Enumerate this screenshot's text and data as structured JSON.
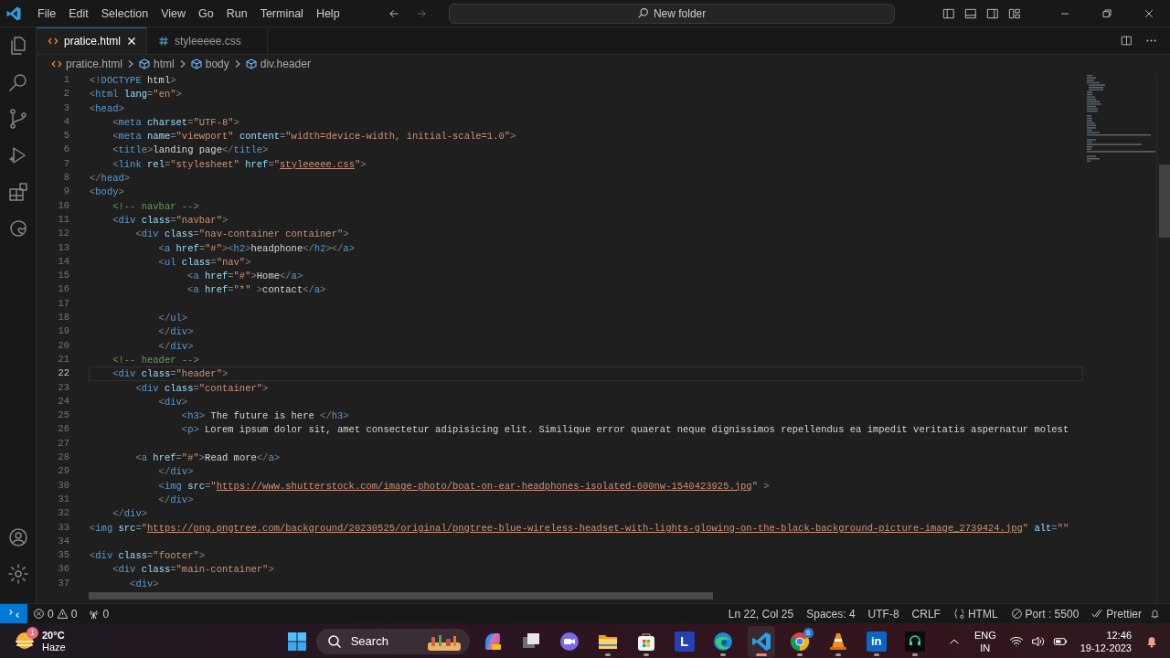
{
  "title_bar": {
    "menu": [
      "File",
      "Edit",
      "Selection",
      "View",
      "Go",
      "Run",
      "Terminal",
      "Help"
    ],
    "command_center": "New folder"
  },
  "tabs": [
    {
      "label": "pratice.html",
      "kind": "html",
      "selected": true
    },
    {
      "label": "styleeeee.css",
      "kind": "css",
      "selected": false
    }
  ],
  "breadcrumb": [
    {
      "label": "pratice.html",
      "kind": "file"
    },
    {
      "label": "html",
      "kind": "element"
    },
    {
      "label": "body",
      "kind": "element"
    },
    {
      "label": "div.header",
      "kind": "element"
    }
  ],
  "editor": {
    "lines": [
      {
        "number": "1",
        "current": false,
        "tokens": [
          {
            "kind": "punct",
            "text": "<!"
          },
          {
            "kind": "tag",
            "text": "DOCTYPE"
          },
          {
            "kind": "text",
            "text": " html"
          },
          {
            "kind": "punct",
            "text": ">"
          }
        ]
      },
      {
        "number": "2",
        "current": false,
        "tokens": [
          {
            "kind": "punct",
            "text": "<"
          },
          {
            "kind": "tag",
            "text": "html"
          },
          {
            "kind": "attr",
            "text": " lang"
          },
          {
            "kind": "punct",
            "text": "="
          },
          {
            "kind": "str",
            "text": "\"en\""
          },
          {
            "kind": "punct",
            "text": ">"
          }
        ]
      },
      {
        "number": "3",
        "current": false,
        "tokens": [
          {
            "kind": "punct",
            "text": "<"
          },
          {
            "kind": "tag",
            "text": "head"
          },
          {
            "kind": "punct",
            "text": ">"
          }
        ]
      },
      {
        "number": "4",
        "current": false,
        "tokens": [
          {
            "kind": "punct",
            "text": "    <"
          },
          {
            "kind": "tag",
            "text": "meta"
          },
          {
            "kind": "attr",
            "text": " charset"
          },
          {
            "kind": "punct",
            "text": "="
          },
          {
            "kind": "str",
            "text": "\"UTF-8\""
          },
          {
            "kind": "punct",
            "text": ">"
          }
        ]
      },
      {
        "number": "5",
        "current": false,
        "tokens": [
          {
            "kind": "punct",
            "text": "    <"
          },
          {
            "kind": "tag",
            "text": "meta"
          },
          {
            "kind": "attr",
            "text": " name"
          },
          {
            "kind": "punct",
            "text": "="
          },
          {
            "kind": "str",
            "text": "\"viewport\""
          },
          {
            "kind": "attr",
            "text": " content"
          },
          {
            "kind": "punct",
            "text": "="
          },
          {
            "kind": "str",
            "text": "\"width=device-width, initial-scale=1.0\""
          },
          {
            "kind": "punct",
            "text": ">"
          }
        ]
      },
      {
        "number": "6",
        "current": false,
        "tokens": [
          {
            "kind": "punct",
            "text": "    <"
          },
          {
            "kind": "tag",
            "text": "title"
          },
          {
            "kind": "punct",
            "text": ">"
          },
          {
            "kind": "text",
            "text": "landing page"
          },
          {
            "kind": "punct",
            "text": "</"
          },
          {
            "kind": "tag",
            "text": "title"
          },
          {
            "kind": "punct",
            "text": ">"
          }
        ]
      },
      {
        "number": "7",
        "current": false,
        "tokens": [
          {
            "kind": "punct",
            "text": "    <"
          },
          {
            "kind": "tag",
            "text": "link"
          },
          {
            "kind": "attr",
            "text": " rel"
          },
          {
            "kind": "punct",
            "text": "="
          },
          {
            "kind": "str",
            "text": "\"stylesheet\""
          },
          {
            "kind": "attr",
            "text": " href"
          },
          {
            "kind": "punct",
            "text": "="
          },
          {
            "kind": "str",
            "text": "\""
          },
          {
            "kind": "link",
            "text": "styleeeee.css"
          },
          {
            "kind": "str",
            "text": "\""
          },
          {
            "kind": "punct",
            "text": ">"
          }
        ]
      },
      {
        "number": "8",
        "current": false,
        "tokens": [
          {
            "kind": "punct",
            "text": "</"
          },
          {
            "kind": "tag",
            "text": "head"
          },
          {
            "kind": "punct",
            "text": ">"
          }
        ]
      },
      {
        "number": "9",
        "current": false,
        "tokens": [
          {
            "kind": "punct",
            "text": "<"
          },
          {
            "kind": "tag",
            "text": "body"
          },
          {
            "kind": "punct",
            "text": ">"
          }
        ]
      },
      {
        "number": "10",
        "current": false,
        "tokens": [
          {
            "kind": "comment",
            "text": "    <!-- navbar -->"
          }
        ]
      },
      {
        "number": "11",
        "current": false,
        "tokens": [
          {
            "kind": "punct",
            "text": "    <"
          },
          {
            "kind": "tag",
            "text": "div"
          },
          {
            "kind": "attr",
            "text": " class"
          },
          {
            "kind": "punct",
            "text": "="
          },
          {
            "kind": "str",
            "text": "\"navbar\""
          },
          {
            "kind": "punct",
            "text": ">"
          }
        ]
      },
      {
        "number": "12",
        "current": false,
        "tokens": [
          {
            "kind": "punct",
            "text": "        <"
          },
          {
            "kind": "tag",
            "text": "div"
          },
          {
            "kind": "attr",
            "text": " class"
          },
          {
            "kind": "punct",
            "text": "="
          },
          {
            "kind": "str",
            "text": "\"nav-container container\""
          },
          {
            "kind": "punct",
            "text": ">"
          }
        ]
      },
      {
        "number": "13",
        "current": false,
        "tokens": [
          {
            "kind": "punct",
            "text": "            <"
          },
          {
            "kind": "tag",
            "text": "a"
          },
          {
            "kind": "attr",
            "text": " href"
          },
          {
            "kind": "punct",
            "text": "="
          },
          {
            "kind": "str",
            "text": "\"#\""
          },
          {
            "kind": "punct",
            "text": "><"
          },
          {
            "kind": "tag",
            "text": "h2"
          },
          {
            "kind": "punct",
            "text": ">"
          },
          {
            "kind": "text",
            "text": "headphone"
          },
          {
            "kind": "punct",
            "text": "</"
          },
          {
            "kind": "tag",
            "text": "h2"
          },
          {
            "kind": "punct",
            "text": "></"
          },
          {
            "kind": "tag",
            "text": "a"
          },
          {
            "kind": "punct",
            "text": ">"
          }
        ]
      },
      {
        "number": "14",
        "current": false,
        "tokens": [
          {
            "kind": "punct",
            "text": "            <"
          },
          {
            "kind": "tag",
            "text": "ul"
          },
          {
            "kind": "attr",
            "text": " class"
          },
          {
            "kind": "punct",
            "text": "="
          },
          {
            "kind": "str",
            "text": "\"nav\""
          },
          {
            "kind": "punct",
            "text": ">"
          }
        ]
      },
      {
        "number": "15",
        "current": false,
        "tokens": [
          {
            "kind": "punct",
            "text": "                 <"
          },
          {
            "kind": "tag",
            "text": "a"
          },
          {
            "kind": "attr",
            "text": " href"
          },
          {
            "kind": "punct",
            "text": "="
          },
          {
            "kind": "str",
            "text": "\"#\""
          },
          {
            "kind": "punct",
            "text": ">"
          },
          {
            "kind": "text",
            "text": "Home"
          },
          {
            "kind": "punct",
            "text": "</"
          },
          {
            "kind": "tag",
            "text": "a"
          },
          {
            "kind": "punct",
            "text": ">"
          }
        ]
      },
      {
        "number": "16",
        "current": false,
        "tokens": [
          {
            "kind": "punct",
            "text": "                 <"
          },
          {
            "kind": "tag",
            "text": "a"
          },
          {
            "kind": "attr",
            "text": " href"
          },
          {
            "kind": "punct",
            "text": "="
          },
          {
            "kind": "str",
            "text": "\"*\""
          },
          {
            "kind": "punct",
            "text": " >"
          },
          {
            "kind": "text",
            "text": "contact"
          },
          {
            "kind": "punct",
            "text": "</"
          },
          {
            "kind": "tag",
            "text": "a"
          },
          {
            "kind": "punct",
            "text": ">"
          }
        ]
      },
      {
        "number": "17",
        "current": false
      },
      {
        "number": "18",
        "current": false,
        "tokens": [
          {
            "kind": "punct",
            "text": "            </"
          },
          {
            "kind": "tag",
            "text": "ul"
          },
          {
            "kind": "punct",
            "text": ">"
          }
        ]
      },
      {
        "number": "19",
        "current": false,
        "tokens": [
          {
            "kind": "punct",
            "text": "            </"
          },
          {
            "kind": "tag",
            "text": "div"
          },
          {
            "kind": "punct",
            "text": ">"
          }
        ]
      },
      {
        "number": "20",
        "current": false,
        "tokens": [
          {
            "kind": "punct",
            "text": "            </"
          },
          {
            "kind": "tag",
            "text": "div"
          },
          {
            "kind": "punct",
            "text": ">"
          }
        ]
      },
      {
        "number": "21",
        "current": false,
        "tokens": [
          {
            "kind": "comment",
            "text": "    <!-- header -->"
          }
        ]
      },
      {
        "number": "22",
        "current": true,
        "tokens": [
          {
            "kind": "punct",
            "text": "    <"
          },
          {
            "kind": "tag",
            "text": "div"
          },
          {
            "kind": "attr",
            "text": " class"
          },
          {
            "kind": "punct",
            "text": "="
          },
          {
            "kind": "str",
            "text": "\"header\""
          },
          {
            "kind": "punct",
            "text": ">"
          }
        ]
      },
      {
        "number": "23",
        "current": false,
        "tokens": [
          {
            "kind": "punct",
            "text": "        <"
          },
          {
            "kind": "tag",
            "text": "div"
          },
          {
            "kind": "attr",
            "text": " class"
          },
          {
            "kind": "punct",
            "text": "="
          },
          {
            "kind": "str",
            "text": "\"container\""
          },
          {
            "kind": "punct",
            "text": ">"
          }
        ]
      },
      {
        "number": "24",
        "current": false,
        "tokens": [
          {
            "kind": "punct",
            "text": "            <"
          },
          {
            "kind": "tag",
            "text": "div"
          },
          {
            "kind": "punct",
            "text": ">"
          }
        ]
      },
      {
        "number": "25",
        "current": false,
        "tokens": [
          {
            "kind": "punct",
            "text": "                <"
          },
          {
            "kind": "tag",
            "text": "h3"
          },
          {
            "kind": "punct",
            "text": ">"
          },
          {
            "kind": "text",
            "text": " The future is here "
          },
          {
            "kind": "punct",
            "text": "</"
          },
          {
            "kind": "tag",
            "text": "h3"
          },
          {
            "kind": "punct",
            "text": ">"
          }
        ]
      },
      {
        "number": "26",
        "current": false,
        "tokens": [
          {
            "kind": "punct",
            "text": "                <"
          },
          {
            "kind": "tag",
            "text": "p"
          },
          {
            "kind": "punct",
            "text": ">"
          },
          {
            "kind": "text",
            "text": " Lorem ipsum dolor sit, amet consectetur adipisicing elit. Similique error quaerat neque dignissimos repellendus ea impedit veritatis aspernatur molest"
          }
        ]
      },
      {
        "number": "27",
        "current": false
      },
      {
        "number": "28",
        "current": false,
        "tokens": [
          {
            "kind": "punct",
            "text": "        <"
          },
          {
            "kind": "tag",
            "text": "a"
          },
          {
            "kind": "attr",
            "text": " href"
          },
          {
            "kind": "punct",
            "text": "="
          },
          {
            "kind": "str",
            "text": "\"#\""
          },
          {
            "kind": "punct",
            "text": ">"
          },
          {
            "kind": "text",
            "text": "Read more"
          },
          {
            "kind": "punct",
            "text": "</"
          },
          {
            "kind": "tag",
            "text": "a"
          },
          {
            "kind": "punct",
            "text": ">"
          }
        ]
      },
      {
        "number": "29",
        "current": false,
        "tokens": [
          {
            "kind": "punct",
            "text": "            </"
          },
          {
            "kind": "tag",
            "text": "div"
          },
          {
            "kind": "punct",
            "text": ">"
          }
        ]
      },
      {
        "number": "30",
        "current": false,
        "tokens": [
          {
            "kind": "punct",
            "text": "            <"
          },
          {
            "kind": "tag",
            "text": "img"
          },
          {
            "kind": "attr",
            "text": " src"
          },
          {
            "kind": "punct",
            "text": "="
          },
          {
            "kind": "str",
            "text": "\""
          },
          {
            "kind": "link",
            "text": "https://www.shutterstock.com/image-photo/boat-on-ear-headphones-isolated-600nw-1540423925.jpg"
          },
          {
            "kind": "str",
            "text": "\""
          },
          {
            "kind": "punct",
            "text": " >"
          }
        ]
      },
      {
        "number": "31",
        "current": false,
        "tokens": [
          {
            "kind": "punct",
            "text": "            </"
          },
          {
            "kind": "tag",
            "text": "div"
          },
          {
            "kind": "punct",
            "text": ">"
          }
        ]
      },
      {
        "number": "32",
        "current": false,
        "tokens": [
          {
            "kind": "punct",
            "text": "    </"
          },
          {
            "kind": "tag",
            "text": "div"
          },
          {
            "kind": "punct",
            "text": ">"
          }
        ]
      },
      {
        "number": "33",
        "current": false,
        "tokens": [
          {
            "kind": "punct",
            "text": "<"
          },
          {
            "kind": "tag",
            "text": "img"
          },
          {
            "kind": "attr",
            "text": " src"
          },
          {
            "kind": "punct",
            "text": "="
          },
          {
            "kind": "str",
            "text": "\""
          },
          {
            "kind": "link",
            "text": "https://png.pngtree.com/background/20230525/original/pngtree-blue-wireless-headset-with-lights-glowing-on-the-black-background-picture-image_2739424.jpg"
          },
          {
            "kind": "str",
            "text": "\""
          },
          {
            "kind": "attr",
            "text": " alt"
          },
          {
            "kind": "punct",
            "text": "="
          },
          {
            "kind": "str",
            "text": "\"\""
          }
        ]
      },
      {
        "number": "34",
        "current": false
      },
      {
        "number": "35",
        "current": false,
        "tokens": [
          {
            "kind": "punct",
            "text": "<"
          },
          {
            "kind": "tag",
            "text": "div"
          },
          {
            "kind": "attr",
            "text": " class"
          },
          {
            "kind": "punct",
            "text": "="
          },
          {
            "kind": "str",
            "text": "\"footer\""
          },
          {
            "kind": "punct",
            "text": ">"
          }
        ]
      },
      {
        "number": "36",
        "current": false,
        "tokens": [
          {
            "kind": "punct",
            "text": "    <"
          },
          {
            "kind": "tag",
            "text": "div"
          },
          {
            "kind": "attr",
            "text": " class"
          },
          {
            "kind": "punct",
            "text": "="
          },
          {
            "kind": "str",
            "text": "\"main-container\""
          },
          {
            "kind": "punct",
            "text": ">"
          }
        ]
      },
      {
        "number": "37",
        "current": false,
        "tokens": [
          {
            "kind": "punct",
            "text": "       <"
          },
          {
            "kind": "tag",
            "text": "div"
          },
          {
            "kind": "punct",
            "text": ">"
          }
        ]
      }
    ]
  },
  "status_bar": {
    "errors": "0",
    "warnings": "0",
    "ports": "0",
    "cursor": "Ln 22, Col 25",
    "indentation": "Spaces: 4",
    "encoding": "UTF-8",
    "line_endings": "CRLF",
    "language": "HTML",
    "live_server": "Port : 5500",
    "formatter": "Prettier"
  },
  "taskbar": {
    "weather": {
      "temperature": "20°C",
      "condition": "Haze",
      "badge": "1"
    },
    "search": "Search",
    "apps": [
      {
        "kind": "copilot",
        "running": false,
        "selected": false
      },
      {
        "kind": "task-view",
        "running": false,
        "selected": false
      },
      {
        "kind": "meet",
        "running": false,
        "selected": false
      },
      {
        "kind": "folder",
        "running": true,
        "selected": false
      },
      {
        "kind": "store",
        "running": true,
        "selected": false
      },
      {
        "kind": "letter",
        "glyph": "L",
        "running": false,
        "selected": false
      },
      {
        "kind": "edge",
        "running": true,
        "selected": false
      },
      {
        "kind": "vscode",
        "running": true,
        "selected": true
      },
      {
        "kind": "chrome",
        "badge": "S",
        "running": true,
        "selected": false
      },
      {
        "kind": "vlc",
        "running": true,
        "selected": false
      },
      {
        "kind": "linkedin",
        "glyph": "in",
        "running": true,
        "selected": false
      },
      {
        "kind": "terminal",
        "running": true,
        "selected": false
      }
    ],
    "language": "ENG",
    "region": "IN",
    "time": "12:46",
    "date": "19-12-2023"
  }
}
